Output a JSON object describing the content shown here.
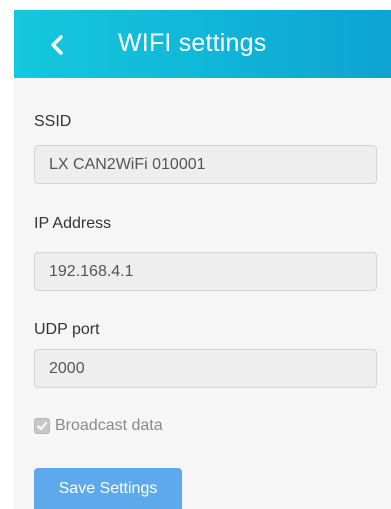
{
  "header": {
    "title": "WIFI settings",
    "back_icon": "chevron-left-icon",
    "gradient_start": "#14c8dd",
    "gradient_end": "#0ea3d2"
  },
  "form": {
    "ssid_label": "SSID",
    "ssid_value": "LX CAN2WiFi 010001",
    "ip_label": "IP Address",
    "ip_value": "192.168.4.1",
    "udp_label": "UDP port",
    "udp_value": "2000",
    "broadcast_label": "Broadcast data",
    "broadcast_checked": true,
    "save_label": "Save Settings"
  },
  "colors": {
    "save_button": "#5ea9ec",
    "content_bg": "#f6f6f6"
  }
}
